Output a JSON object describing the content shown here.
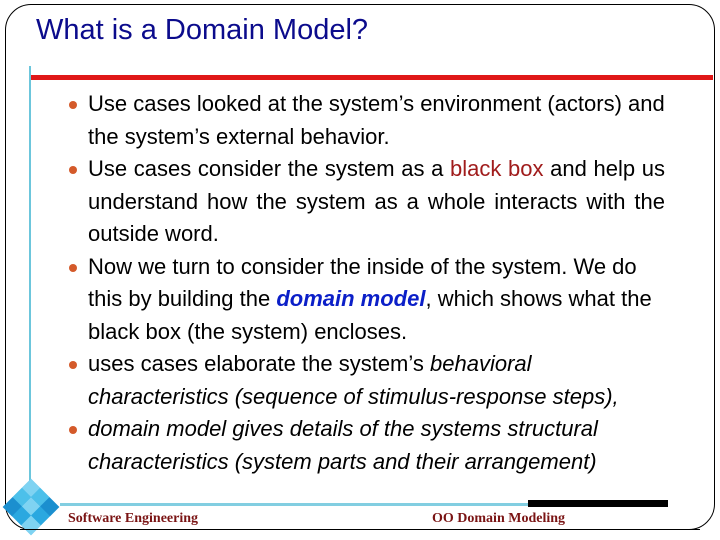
{
  "slide": {
    "title": "What is a Domain Model?",
    "bullets": [
      {
        "text": "Use cases looked at the system’s environment (actors) and the system’s external behavior."
      },
      {
        "text_before": "Use cases consider the system as a ",
        "highlight": "black box",
        "text_after": " and help us  understand how the system as a whole interacts with the outside word."
      },
      {
        "text_before": "Now we turn to consider the inside of the system. We do this by building the ",
        "emphasis": "domain model",
        "text_after": ", which shows what the black box (the system) encloses."
      },
      {
        "text_before": "uses cases elaborate the system’s ",
        "italic": "behavioral characteristics (sequence of stimulus-response steps),"
      },
      {
        "italic": "domain model gives details of the systems structural characteristics (system parts and their arrangement)"
      }
    ],
    "footer": {
      "left": "Software Engineering",
      "right": "OO Domain  Modeling"
    },
    "colors": {
      "title": "#0b0b8c",
      "rule": "#e01818",
      "accent_line": "#6cc6dc",
      "bullet": "#d45a2a",
      "highlight": "#a01c1c",
      "emphasis": "#0b1fc8",
      "footer": "#7a1414"
    },
    "icons": {
      "logo": "diamond-tile-logo",
      "bullet": "round-bullet"
    }
  }
}
